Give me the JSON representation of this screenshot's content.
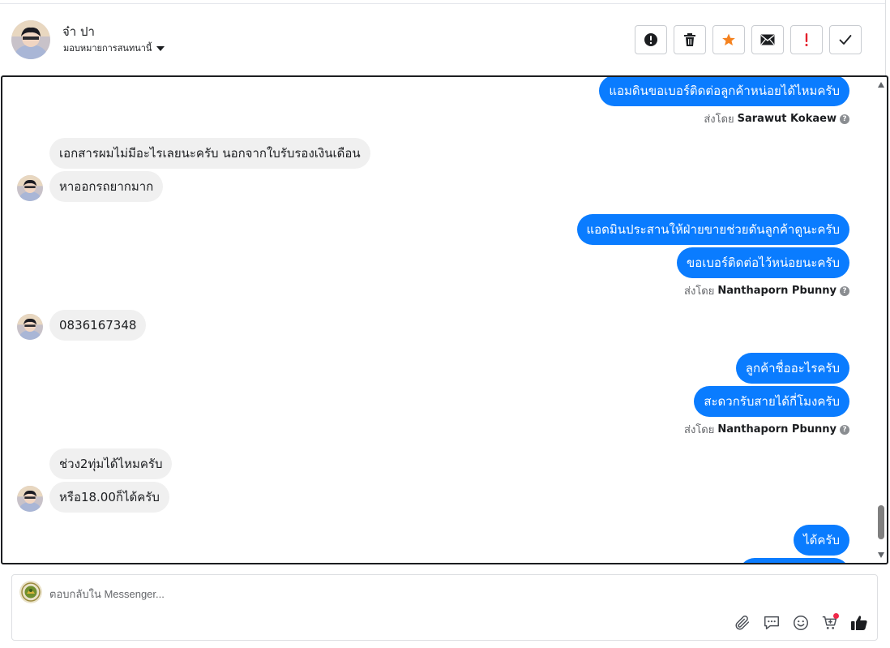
{
  "header": {
    "contact_name": "จ๋า ปา",
    "assign_label": "มอบหมายการสนทนานี้"
  },
  "actions": [
    {
      "name": "mark-spam-button",
      "icon": "alert-circle-icon"
    },
    {
      "name": "delete-button",
      "icon": "trash-icon"
    },
    {
      "name": "star-button",
      "icon": "star-icon"
    },
    {
      "name": "mark-unread-button",
      "icon": "mail-icon"
    },
    {
      "name": "follow-up-button",
      "icon": "exclamation-icon"
    },
    {
      "name": "mark-done-button",
      "icon": "check-icon"
    }
  ],
  "messages": {
    "m1": "แอมดินขอเบอร์ติดต่อลูกค้าหน่อยได้ไหมครับ",
    "m1_sent_prefix": "ส่งโดย",
    "m1_sent_by": "Sarawut Kokaew",
    "m2": "เอกสารผมไม่มีอะไรเลยนะครับ นอกจากใบรับรองเงินเดือน",
    "m3": "หาออกรถยากมาก",
    "m4": "แอดมินประสานให้ฝ่ายขายช่วยดันลูกค้าดูนะครับ",
    "m5": "ขอเบอร์ติดต่อไว้หน่อยนะครับ",
    "m5_sent_prefix": "ส่งโดย",
    "m5_sent_by": "Nanthaporn Pbunny",
    "m6": "0836167348",
    "m7": "ลูกค้าชื่ออะไรครับ",
    "m8": "สะดวกรับสายได้กี่โมงครับ",
    "m8_sent_prefix": "ส่งโดย",
    "m8_sent_by": "Nanthaporn Pbunny",
    "m9": "ช่วง2ทุ่มได้ไหมครับ",
    "m10": "หรือ18.00ก็ได้ครับ",
    "m11": "ได้ครับ"
  },
  "composer": {
    "placeholder": "ตอบกลับใน Messenger..."
  },
  "colors": {
    "outgoing_bubble": "#0a7cff",
    "incoming_bubble": "#f0f0f0",
    "star": "#f5821f",
    "follow_up": "#e4202c",
    "notification_dot": "#f02849"
  }
}
